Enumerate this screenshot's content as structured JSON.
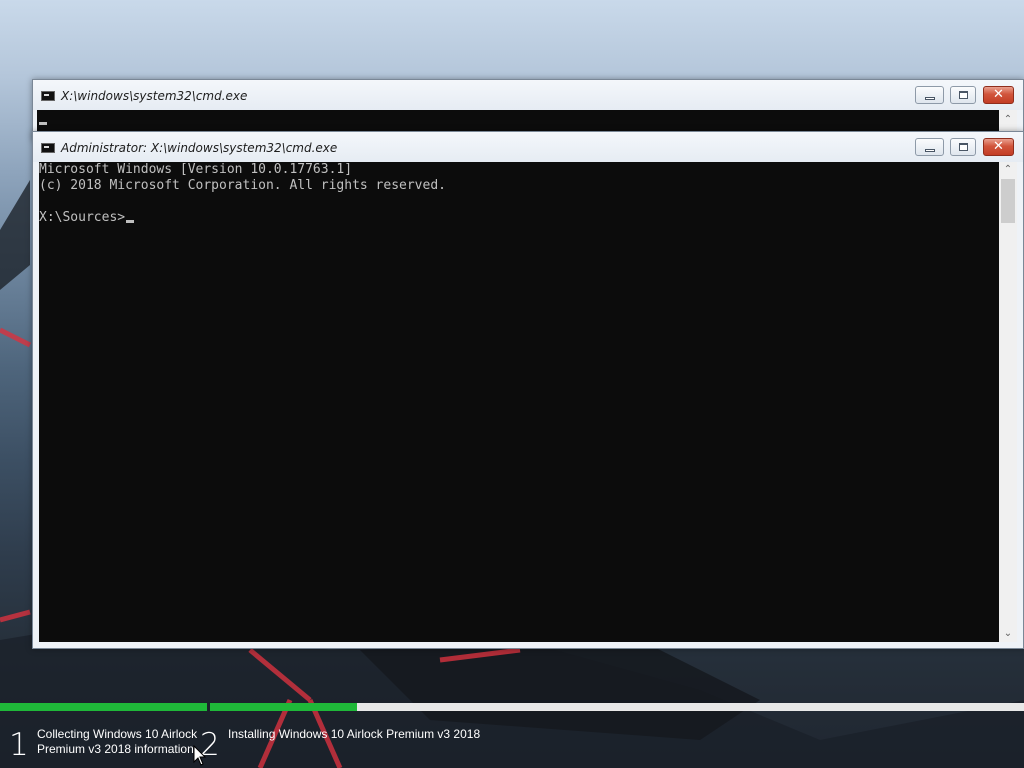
{
  "windows": {
    "back": {
      "title": "X:\\windows\\system32\\cmd.exe",
      "icon": "console-icon"
    },
    "front": {
      "title": "Administrator: X:\\windows\\system32\\cmd.exe",
      "icon": "console-icon",
      "lines": [
        "Microsoft Windows [Version 10.0.17763.1]",
        "(c) 2018 Microsoft Corporation. All rights reserved.",
        "",
        "X:\\Sources>"
      ],
      "prompt": "X:\\Sources>"
    },
    "controls": {
      "minimize_icon": "minimize-icon",
      "maximize_icon": "maximize-icon",
      "close_glyph": "✕"
    }
  },
  "setup": {
    "steps": [
      {
        "number": "1",
        "label": "Collecting Windows 10 Airlock Premium v3 2018 information",
        "progress": 1.0
      },
      {
        "number": "2",
        "label": "Installing Windows 10 Airlock Premium v3 2018",
        "progress": 0.18
      }
    ],
    "colors": {
      "progress": "#1fb839",
      "track": "#e8e8e8"
    }
  }
}
